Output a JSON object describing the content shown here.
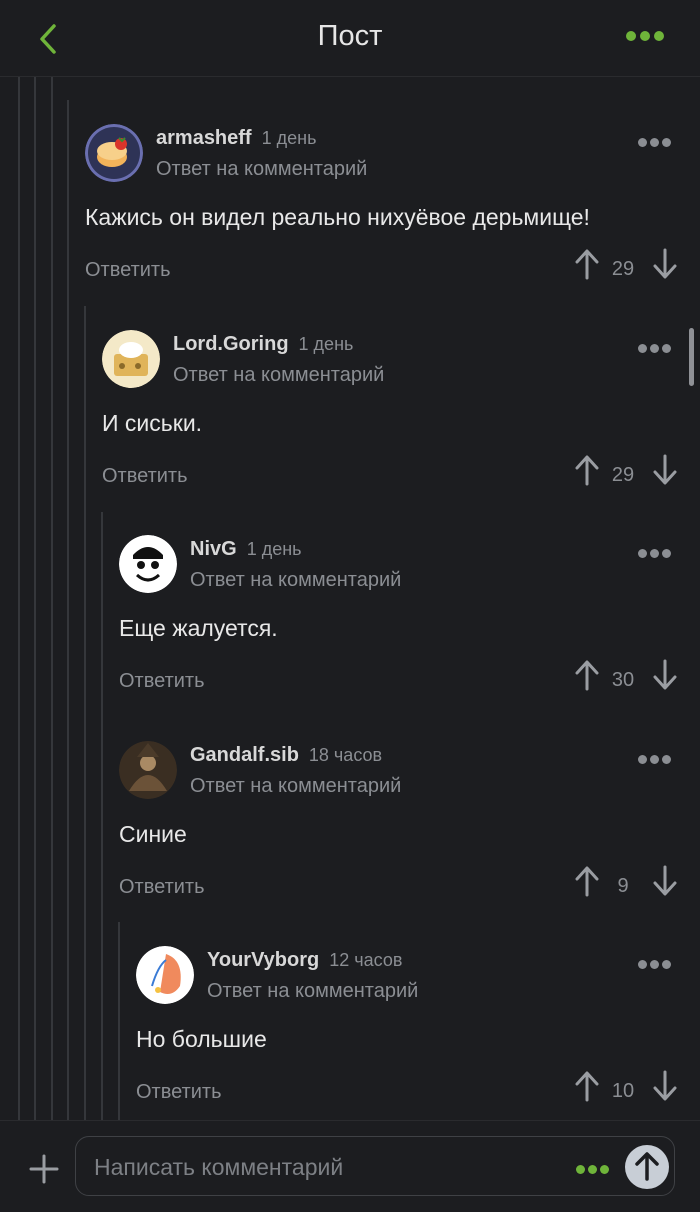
{
  "header": {
    "title": "Пост",
    "back_icon": "chevron-left-icon",
    "more_icon": "more-dots-icon",
    "accent": "#6fb43a"
  },
  "comments": [
    {
      "username": "armasheff",
      "time": "1 день",
      "subtitle": "Ответ на комментарий",
      "text": "Кажись он видел реально нихуёвое дерьмище!",
      "reply": "Ответить",
      "score": "29"
    },
    {
      "username": "Lord.Goring",
      "time": "1 день",
      "subtitle": "Ответ на комментарий",
      "text": "И сиськи.",
      "reply": "Ответить",
      "score": "29"
    },
    {
      "username": "NivG",
      "time": "1 день",
      "subtitle": "Ответ на комментарий",
      "text": "Еще жалуется.",
      "reply": "Ответить",
      "score": "30"
    },
    {
      "username": "Gandalf.sib",
      "time": "18 часов",
      "subtitle": "Ответ на комментарий",
      "text": "Синие",
      "reply": "Ответить",
      "score": "9"
    },
    {
      "username": "YourVyborg",
      "time": "12 часов",
      "subtitle": "Ответ на комментарий",
      "text": "Но большие",
      "reply": "Ответить",
      "score": "10"
    }
  ],
  "footer": {
    "placeholder": "Написать комментарий",
    "plus_icon": "plus-icon",
    "send_icon": "arrow-up-icon"
  }
}
